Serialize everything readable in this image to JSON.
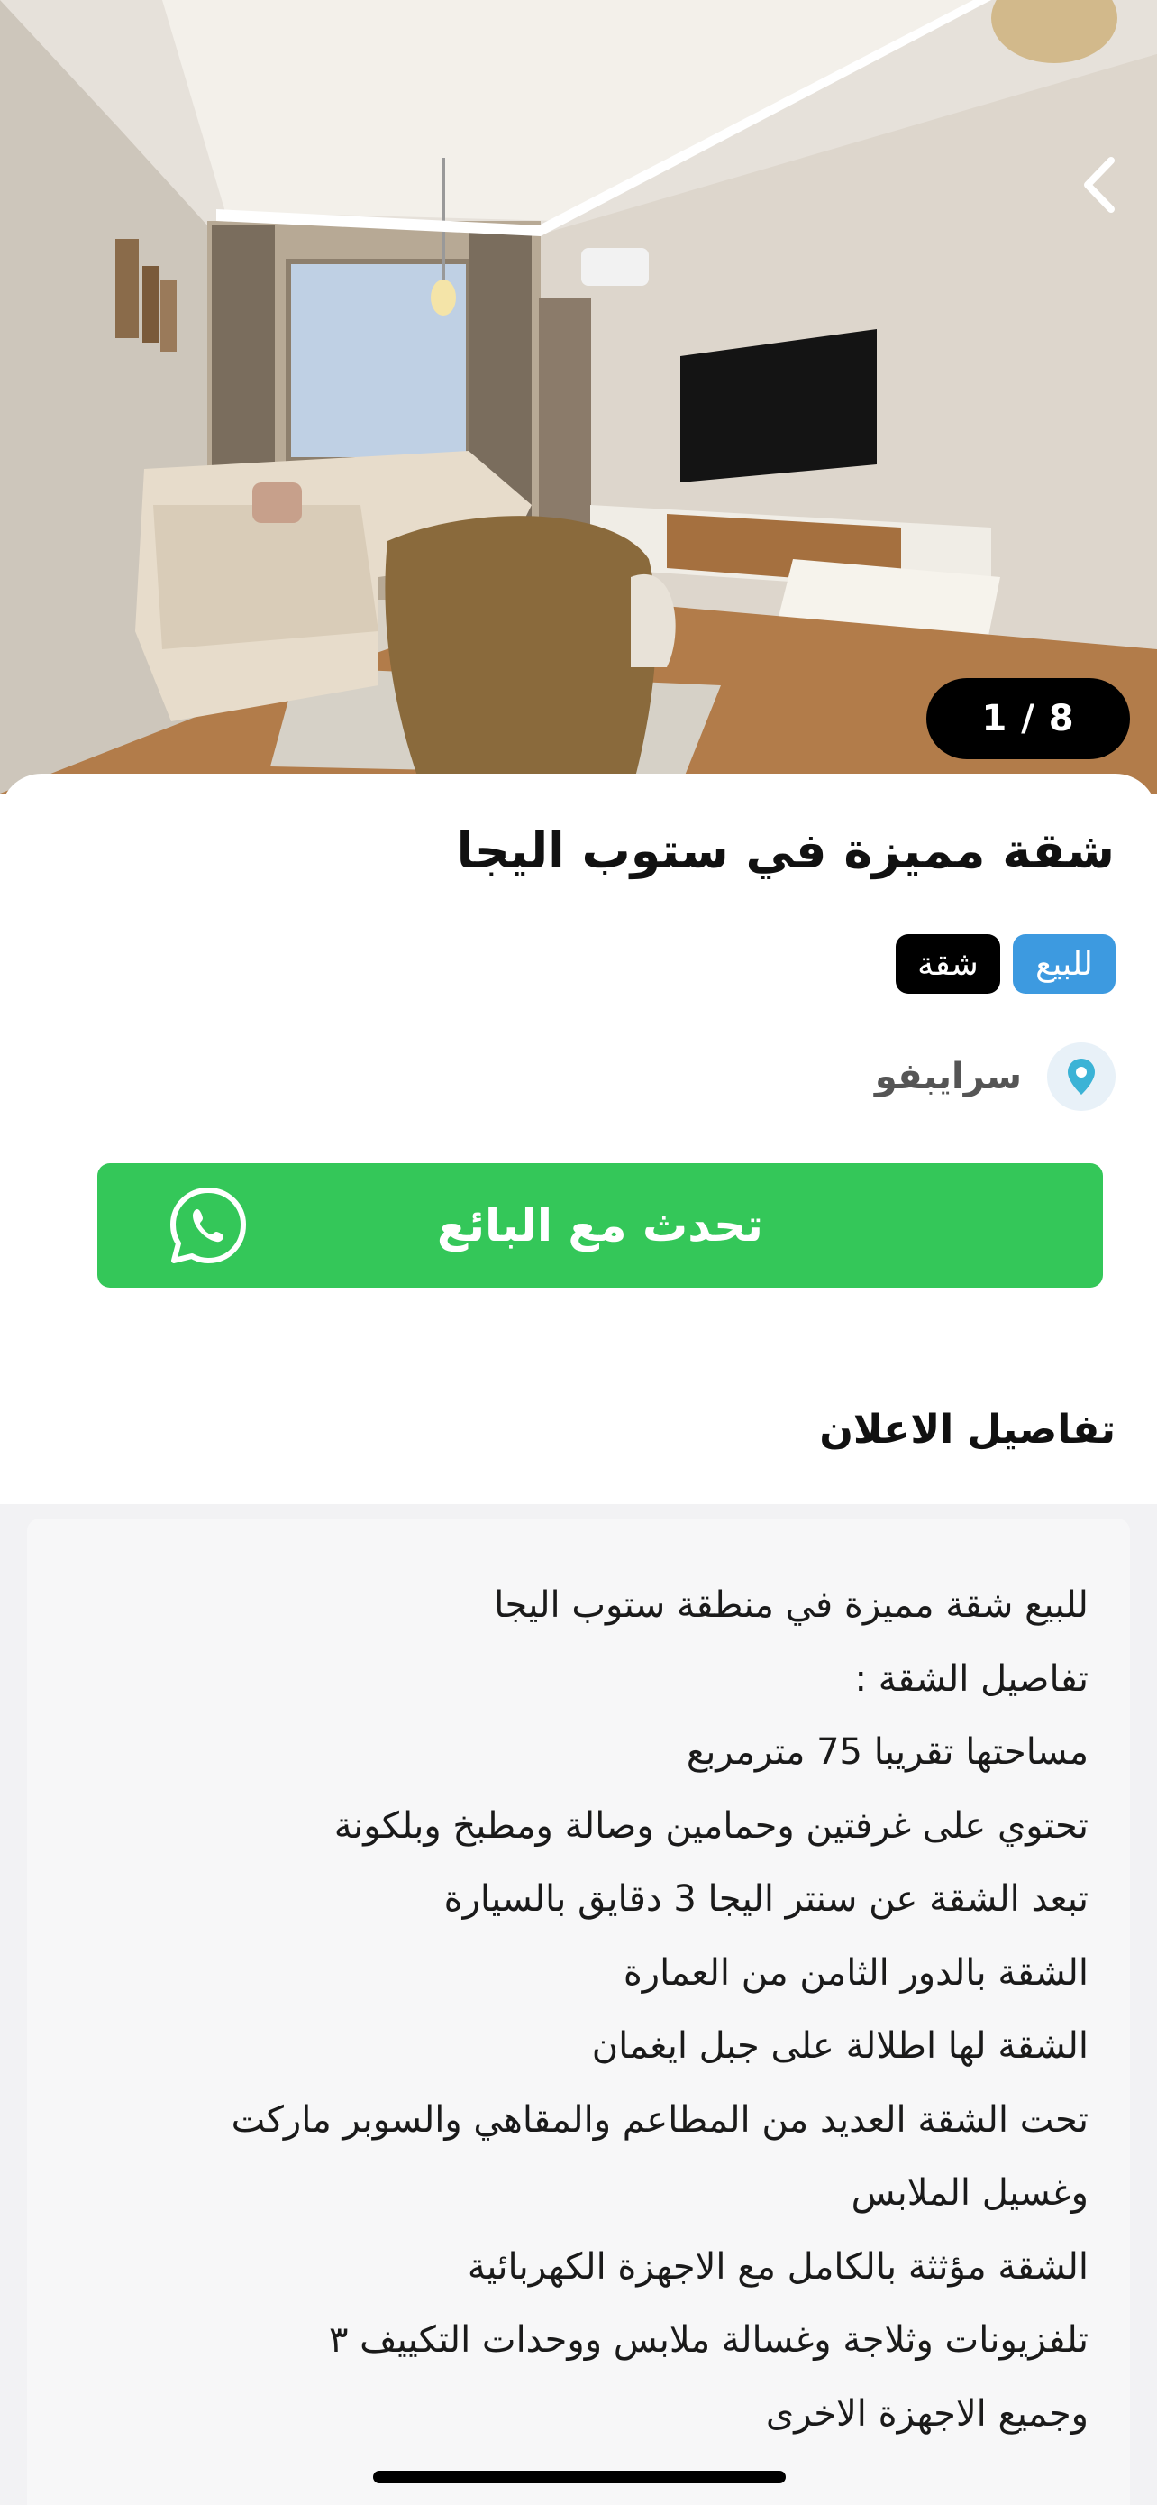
{
  "gallery": {
    "counter": "1 / 8",
    "back_icon": "chevron-left-icon"
  },
  "listing": {
    "title": "شقة مميزة في ستوب اليجا",
    "tags": [
      {
        "label": "للبيع",
        "color": "#3d9ae0"
      },
      {
        "label": "شقة",
        "color": "#000000"
      }
    ],
    "location": "سرايبفو",
    "location_icon": "location-pin-icon"
  },
  "contact": {
    "whatsapp_label": "تحدث مع البائع",
    "icon": "whatsapp-icon",
    "color": "#34c759"
  },
  "details": {
    "section_title": "تفاصيل الاعلان",
    "lines": [
      "للبيع شقة مميزة في منطقة ستوب اليجا",
      "تفاصيل الشقة :",
      "مساحتها تقريبا 75 مترمربع",
      "تحتوي على غرفتين وحمامين وصالة ومطبخ وبلكونة",
      "تبعد الشقة عن سنتر اليجا 3  دقايق بالسيارة",
      "الشقة بالدور الثامن من العمارة",
      "الشقة لها اطلالة على جبل ايغمان",
      "تحت الشقة العديد من المطاعم والمقاهي والسوبر ماركت",
      "وغسيل الملابس",
      "الشقة مؤثثة بالكامل مع الاجهزة الكهربائية",
      "تلفزيونات وثلاجة وغسالة ملابس ووحدات التكييف ٣",
      "وجميع الاجهزة الاخرى"
    ]
  }
}
